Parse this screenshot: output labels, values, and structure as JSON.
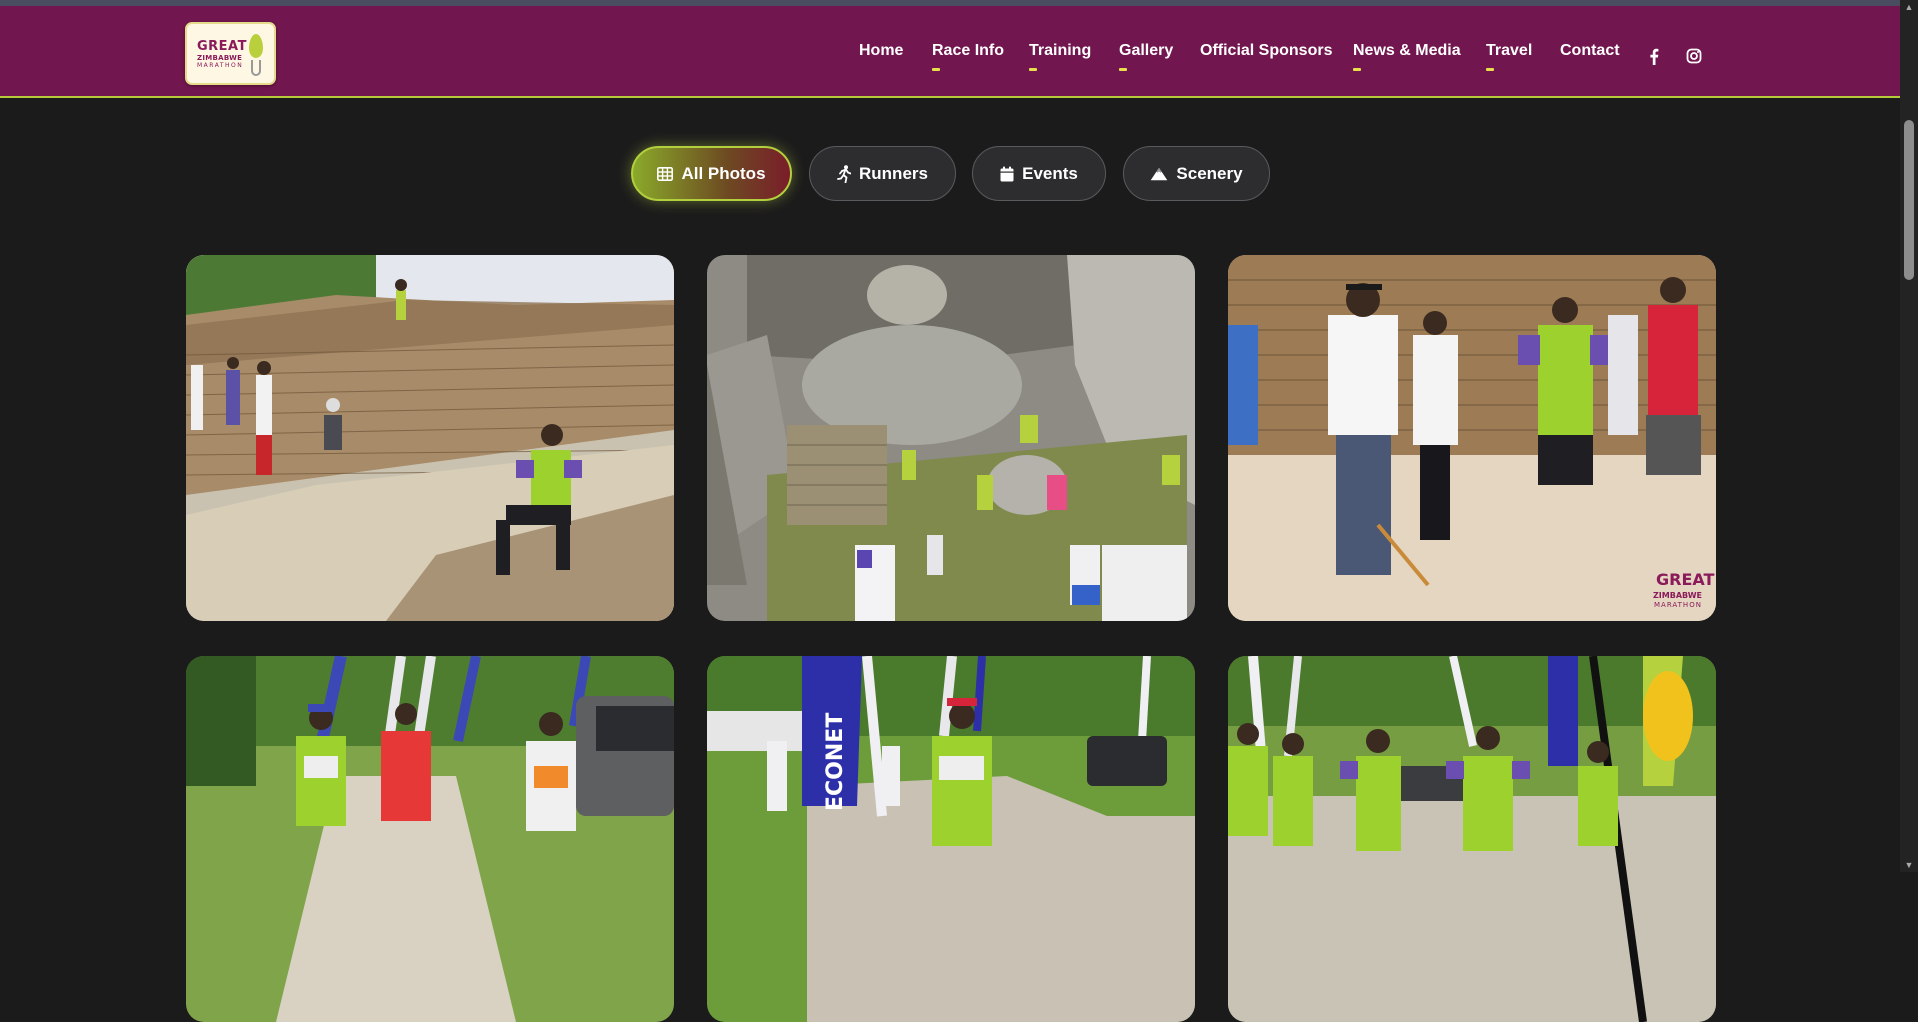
{
  "logo": {
    "line1": "GREAT",
    "line2": "ZIMBABWE",
    "line3": "MARATHON"
  },
  "nav": {
    "items": [
      {
        "label": "Home",
        "has_dropdown": false
      },
      {
        "label": "Race Info",
        "has_dropdown": true
      },
      {
        "label": "Training",
        "has_dropdown": true
      },
      {
        "label": "Gallery",
        "has_dropdown": true
      },
      {
        "label": "Official Sponsors",
        "has_dropdown": false
      },
      {
        "label": "News & Media",
        "has_dropdown": true
      },
      {
        "label": "Travel",
        "has_dropdown": true
      },
      {
        "label": "Contact",
        "has_dropdown": false
      }
    ],
    "social": [
      "facebook-icon",
      "instagram-icon"
    ]
  },
  "filters": [
    {
      "label": "All Photos",
      "icon": "grid-icon",
      "active": true
    },
    {
      "label": "Runners",
      "icon": "running-icon",
      "active": false
    },
    {
      "label": "Events",
      "icon": "calendar-icon",
      "active": false
    },
    {
      "label": "Scenery",
      "icon": "mountain-icon",
      "active": false
    }
  ],
  "gallery": {
    "photos": [
      {
        "watermark": ""
      },
      {
        "watermark": ""
      },
      {
        "watermark": "GREAT ZIMBABWE MARATHON"
      },
      {
        "watermark": ""
      },
      {
        "watermark": ""
      },
      {
        "watermark": ""
      }
    ]
  },
  "colors": {
    "header_bg": "#72164f",
    "accent_lime": "#b2cf3e",
    "page_bg": "#1c1b1c"
  }
}
